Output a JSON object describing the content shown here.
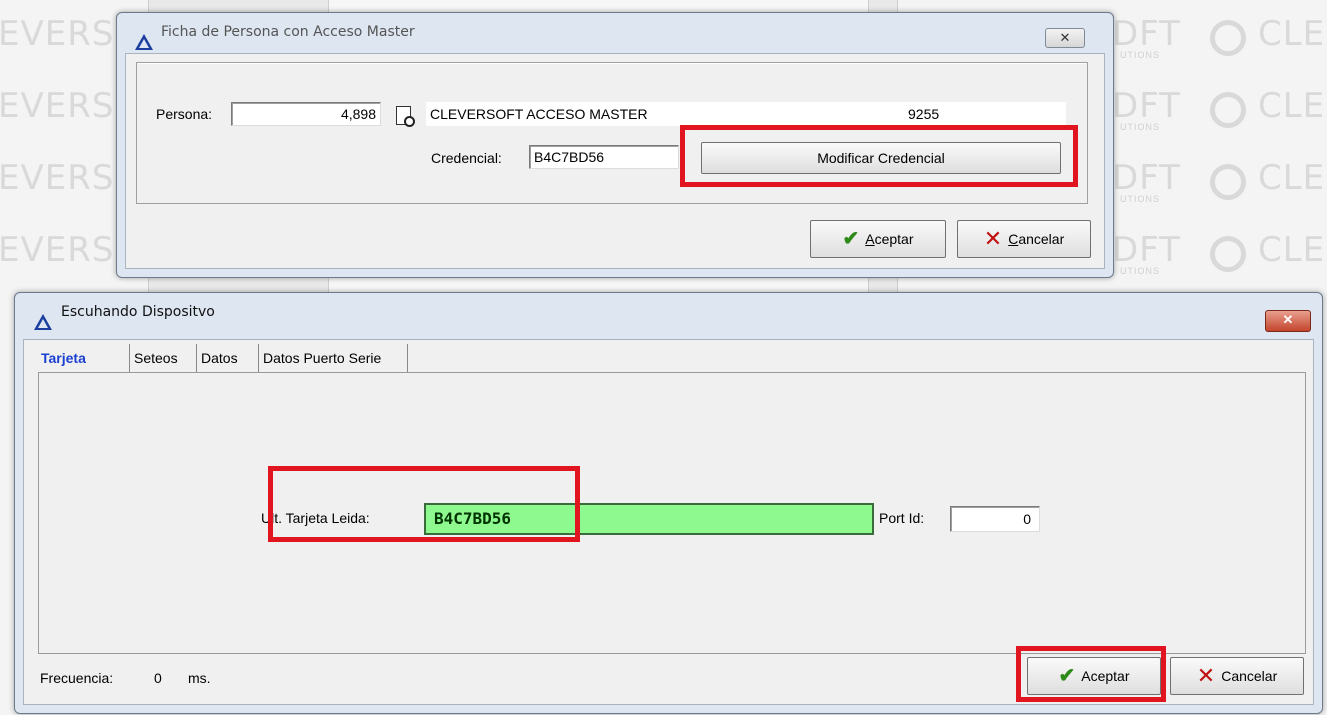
{
  "background": {
    "watermark_text": "EVERS",
    "watermark_text_right": "CLE",
    "watermark_suffix": "DFT",
    "watermark_sub": "UTIONS"
  },
  "ficha": {
    "title": "Ficha de Persona con Acceso Master",
    "close_glyph": "✕",
    "persona_label": "Persona:",
    "persona_value": "4,898",
    "persona_name": "CLEVERSOFT ACCESO MASTER",
    "persona_code": "9255",
    "credencial_label": "Credencial:",
    "credencial_value": "B4C7BD56",
    "modificar_label": "Modificar Credencial",
    "aceptar_label": "Aceptar",
    "aceptar_mnemonic": "A",
    "aceptar_rest": "ceptar",
    "cancelar_mnemonic": "C",
    "cancelar_rest": "ancelar"
  },
  "escuchando": {
    "title": "Escuhando Dispositvo",
    "close_glyph": "✕",
    "tabs": [
      {
        "label": "Tarjeta"
      },
      {
        "label": "Seteos"
      },
      {
        "label": "Datos"
      },
      {
        "label": "Datos Puerto Serie"
      }
    ],
    "ult_tarjeta_label": "Ult. Tarjeta Leida:",
    "ult_tarjeta_value": "B4C7BD56",
    "port_id_label": "Port Id:",
    "port_id_value": "0",
    "frecuencia_label": "Frecuencia:",
    "frecuencia_value": "0",
    "frecuencia_unit": "ms.",
    "aceptar_label": "Aceptar",
    "cancelar_label": "Cancelar"
  },
  "colors": {
    "highlight": "#e0151f",
    "card_reading": "#8ef98e",
    "active_tab": "#1a3fd1"
  },
  "icons": [
    "triangle-app-icon",
    "search-doc-icon",
    "check-icon",
    "cross-icon",
    "close-icon"
  ]
}
